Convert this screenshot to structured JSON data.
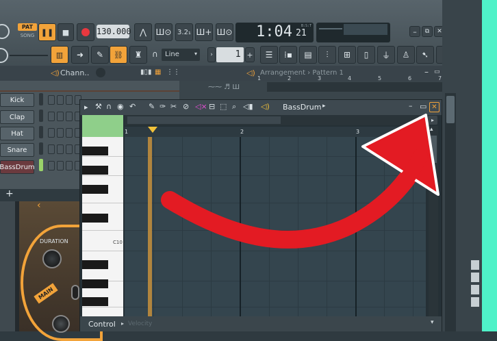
{
  "toolbar": {
    "pat_label": "PAT",
    "song_label": "SONG",
    "tempo": "130.000",
    "time_display": "1:04",
    "time_sub": "21",
    "bst_label": "B:S:T",
    "snap_select": "Line",
    "pattern_number": "1",
    "win_minimize": "–",
    "win_restore": "⧉",
    "win_close": "✕",
    "pitch_label": "3.2₁"
  },
  "channel_rack": {
    "title": "Chann..",
    "items": [
      "Kick",
      "Clap",
      "Hat",
      "Snare",
      "BassDrum"
    ],
    "add_label": "+"
  },
  "playlist": {
    "breadcrumb": "Arrangement › Pattern 1",
    "ruler": [
      "1",
      "2",
      "3",
      "4",
      "5",
      "6",
      "7"
    ]
  },
  "piano_roll": {
    "channel": "BassDrum",
    "ruler": [
      "1",
      "2",
      "3"
    ],
    "octave_label": "C10",
    "control_label": "Control",
    "control_value": "Velocity"
  },
  "plugin": {
    "duration_label": "DURATION",
    "main_label": "MAIN"
  },
  "annotation": {
    "color": "#e31b23"
  },
  "colors": {
    "accent_orange": "#f2a33a",
    "mint": "#4ff2c8",
    "grid_bg": "#34454e"
  }
}
